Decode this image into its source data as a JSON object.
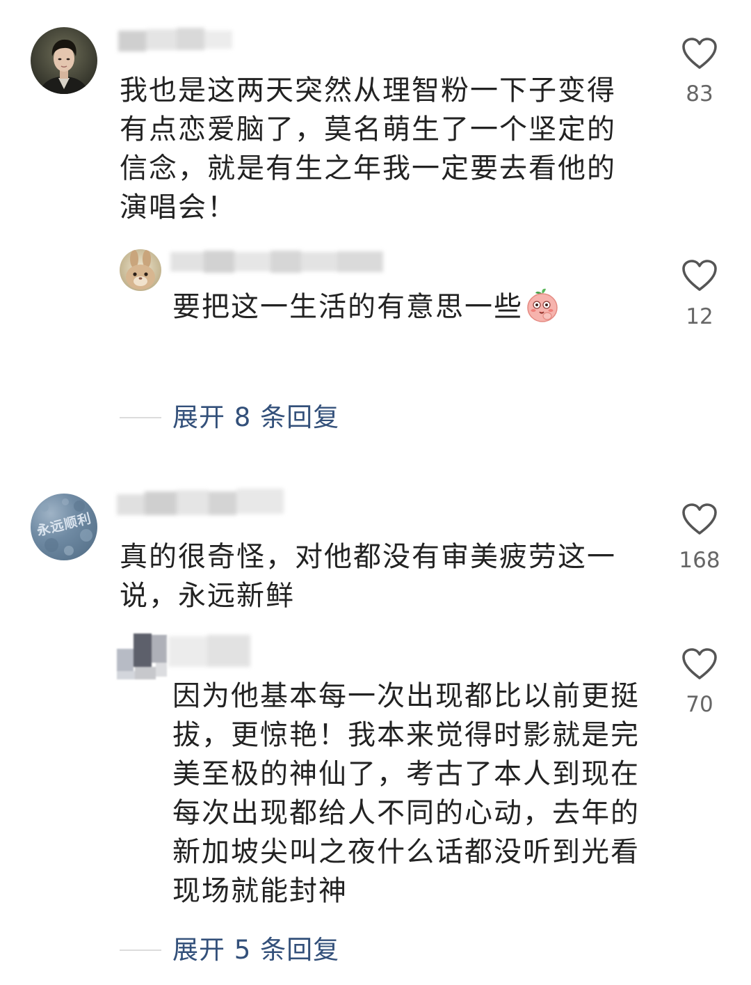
{
  "comments": [
    {
      "text": "我也是这两天突然从理智粉一下子变得有点恋爱脑了，莫名萌生了一个坚定的信念，就是有生之年我一定要去看他的演唱会！",
      "likes": "83",
      "avatar": "portrait-avatar",
      "reply": {
        "text": "要把这一生活的有意思一些",
        "emoji": "peach-face-emoji",
        "likes": "12",
        "avatar": "rabbit-avatar"
      },
      "expand_label": "展开 8 条回复"
    },
    {
      "text": "真的很奇怪，对他都没有审美疲劳这一说，永远新鲜",
      "likes": "168",
      "avatar": "blue-texture-avatar",
      "avatar_label": "永远顺利",
      "reply": {
        "text": "因为他基本每一次出现都比以前更挺拔，更惊艳！我本来觉得时影就是完美至极的神仙了，考古了本人到现在每次出现都给人不同的心动，去年的新加坡尖叫之夜什么话都没听到光看现场就能封神",
        "likes": "70",
        "avatar": "mosaic-avatar"
      },
      "expand_label": "展开 5 条回复"
    }
  ],
  "icons": {
    "like": "heart-outline-icon"
  },
  "colors": {
    "text": "#222222",
    "count": "#666666",
    "expand": "#33507a",
    "heart_stroke": "#555555",
    "background": "#ffffff"
  }
}
